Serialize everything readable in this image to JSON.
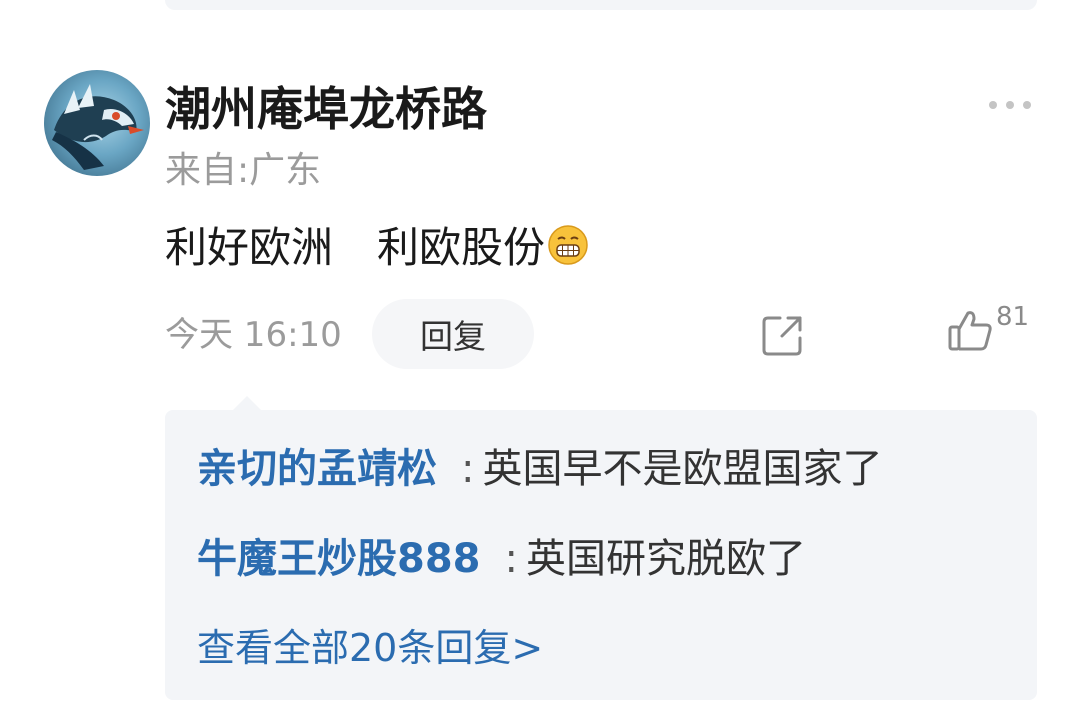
{
  "comment": {
    "username": "潮州庵埠龙桥路",
    "location": "来自:广东",
    "text_part1": "利好欧洲",
    "text_part2": "利欧股份",
    "emoji": "grinning-face-emoji",
    "timestamp": "今天 16:10",
    "reply_label": "回复",
    "like_count": "81"
  },
  "replies": [
    {
      "author": "亲切的孟靖松",
      "separator": ":",
      "content": "英国早不是欧盟国家了"
    },
    {
      "author": "牛魔王炒股888",
      "separator": ":",
      "content": "英国研究脱欧了"
    }
  ],
  "view_all_label": "查看全部20条回复>",
  "icons": {
    "avatar": "dragon-avatar",
    "more": "more-dots-icon",
    "share": "share-icon",
    "like": "thumbs-up-icon"
  },
  "colors": {
    "link_blue": "#2b6cb0",
    "muted_gray": "#9b9b9b",
    "reply_bg": "#f3f5f8"
  }
}
